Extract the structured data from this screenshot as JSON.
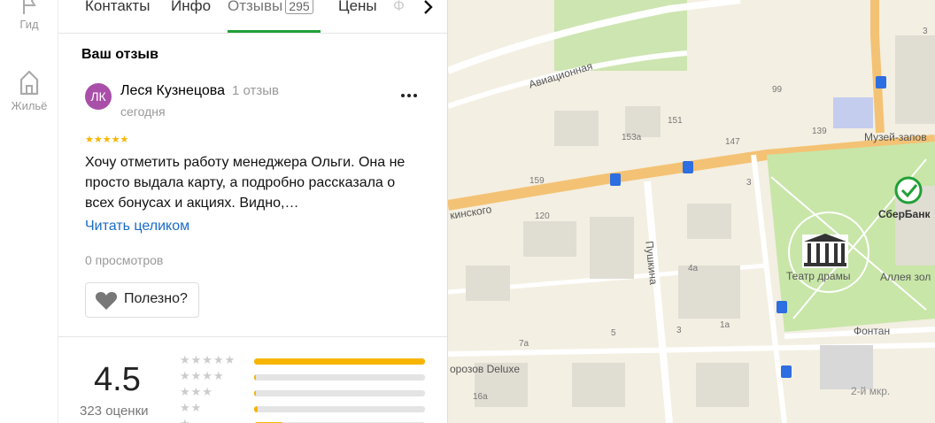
{
  "rail": {
    "items": [
      {
        "label": "Гид",
        "icon": "flag-icon"
      },
      {
        "label": "Жильё",
        "icon": "home-icon"
      }
    ]
  },
  "tabs": [
    {
      "label": "Контакты"
    },
    {
      "label": "Инфо"
    },
    {
      "label": "Отзывы",
      "count": "295",
      "active": true
    },
    {
      "label": "Цены"
    },
    {
      "label": "Ф"
    }
  ],
  "review": {
    "section_title": "Ваш отзыв",
    "avatar_initials": "ЛК",
    "avatar_color": "#a94fa9",
    "author": "Леся Кузнецова",
    "author_reviews": "1 отзыв",
    "date": "сегодня",
    "stars": 5,
    "stars_text": "★★★★★",
    "text": "Хочу отметить работу менеджера Ольги. Она не просто выдала карту, а подробно рассказала о всех бонусах и акциях. Видно,…",
    "read_more": "Читать целиком",
    "views": "0 просмотров",
    "helpful": "Полезно?"
  },
  "summary": {
    "rating": "4.5",
    "count": "323 оценки",
    "distribution": [
      {
        "stars": "★★★★★",
        "fraction": 1.0
      },
      {
        "stars": "★★★★",
        "fraction": 0.01
      },
      {
        "stars": "★★★",
        "fraction": 0.01
      },
      {
        "stars": "★★",
        "fraction": 0.02
      },
      {
        "stars": "★",
        "fraction": 0.17
      }
    ]
  },
  "map": {
    "labels": {
      "aviation": "Авиационная",
      "museum": "Музей-запов",
      "kinskogo": "кинского",
      "pushkina": "Пушкина",
      "sberbank": "СберБанк",
      "theatre": "Театр драмы",
      "alley": "Аллея зол",
      "fountain": "Фонтан",
      "morozov": "орозов Deluxe",
      "district": "2-й мкр."
    },
    "numbers": [
      "99",
      "151",
      "153а",
      "147",
      "139",
      "159",
      "120",
      "3",
      "4а",
      "1а",
      "5",
      "3",
      "7а",
      "16а",
      "3"
    ],
    "colors": {
      "road": "#f4c274",
      "park": "#c8e6a8",
      "bus_stop": "#2d6ee0",
      "building": "#e0ddd3"
    }
  }
}
